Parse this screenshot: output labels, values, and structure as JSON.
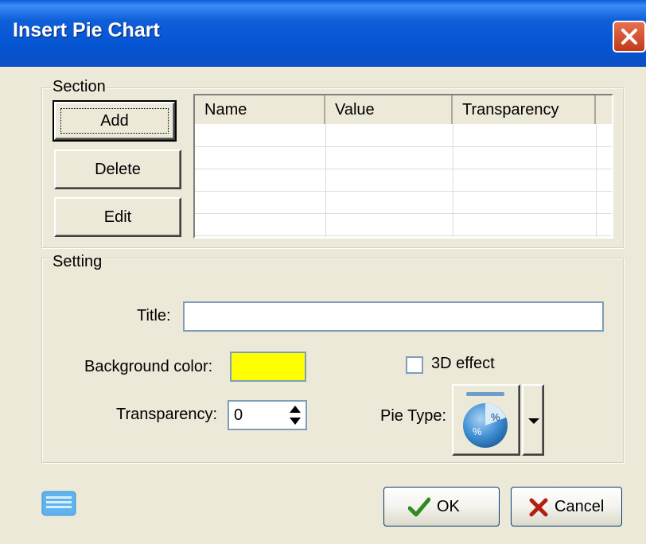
{
  "window": {
    "title": "Insert Pie Chart"
  },
  "section": {
    "legend": "Section",
    "buttons": {
      "add": "Add",
      "delete": "Delete",
      "edit": "Edit"
    },
    "table": {
      "columns": [
        "Name",
        "Value",
        "Transparency"
      ],
      "rows": []
    }
  },
  "setting": {
    "legend": "Setting",
    "title_label": "Title:",
    "title_value": "",
    "background_color_label": "Background color:",
    "background_color": "#ffff00",
    "effect_3d_label": "3D effect",
    "effect_3d_checked": false,
    "transparency_label": "Transparency:",
    "transparency_value": "0",
    "pie_type_label": "Pie Type:"
  },
  "footer": {
    "ok_label": "OK",
    "cancel_label": "Cancel"
  },
  "icons": {
    "keyboard": "keyboard-icon",
    "ok": "checkmark-icon",
    "cancel": "x-icon",
    "pie": "pie-percent-icon"
  }
}
